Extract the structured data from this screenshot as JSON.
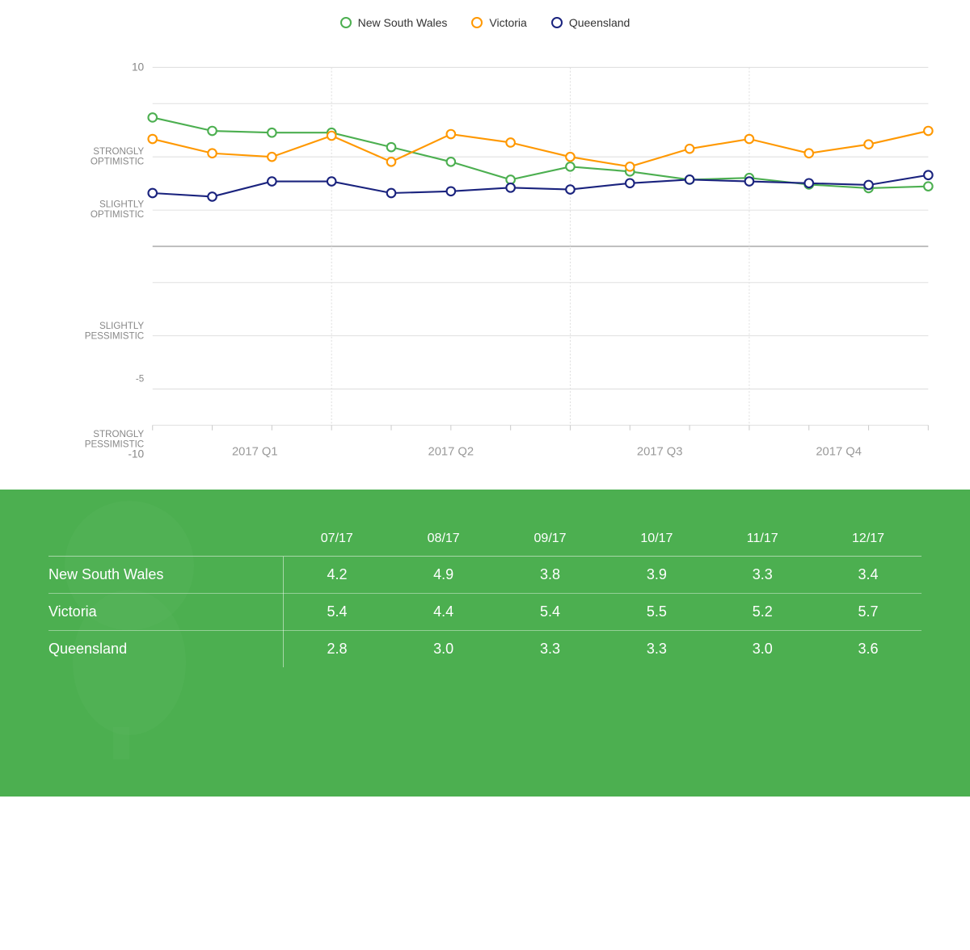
{
  "legend": {
    "items": [
      {
        "label": "New South Wales",
        "class": "nsw",
        "color": "#4caf50"
      },
      {
        "label": "Victoria",
        "class": "vic",
        "color": "#ff9800"
      },
      {
        "label": "Queensland",
        "class": "qld",
        "color": "#1a237e"
      }
    ]
  },
  "chart": {
    "yAxis": {
      "max": 10,
      "min": -10,
      "labels": [
        {
          "value": 10,
          "text": "10"
        },
        {
          "value": 7.5,
          "text": "STRONGLY\nOPTIMISTIC"
        },
        {
          "value": 2.5,
          "text": "SLIGHTLY\nOPTIMISTIC"
        },
        {
          "value": -2.5,
          "text": "SLIGHTLY\nPESSIMISTIC"
        },
        {
          "value": -7.5,
          "text": "STRONGLY\nPESSIMISTIC"
        },
        {
          "value": -10,
          "text": "-10"
        }
      ]
    },
    "xAxis": {
      "labels": [
        "2017 Q1",
        "2017 Q2",
        "2017 Q3",
        "2017 Q4"
      ]
    },
    "series": {
      "nsw": {
        "color": "#4caf50",
        "points": [
          7.2,
          6.5,
          6.4,
          6.4,
          5.6,
          4.8,
          3.8,
          4.5,
          4.2,
          3.8,
          3.9,
          3.5,
          3.3,
          3.4
        ]
      },
      "vic": {
        "color": "#ff9800",
        "points": [
          6.0,
          5.2,
          5.0,
          6.2,
          4.8,
          6.3,
          5.8,
          5.0,
          4.5,
          5.5,
          6.0,
          5.2,
          5.7,
          6.5
        ]
      },
      "qld": {
        "color": "#1a237e",
        "points": [
          2.5,
          2.3,
          3.2,
          3.2,
          2.5,
          2.6,
          2.8,
          2.7,
          3.1,
          3.3,
          3.2,
          3.1,
          3.0,
          3.6
        ]
      }
    }
  },
  "table": {
    "columns": [
      "",
      "07/17",
      "08/17",
      "09/17",
      "10/17",
      "11/17",
      "12/17"
    ],
    "rows": [
      {
        "label": "New South Wales",
        "values": [
          "4.2",
          "4.9",
          "3.8",
          "3.9",
          "3.3",
          "3.4"
        ]
      },
      {
        "label": "Victoria",
        "values": [
          "5.4",
          "4.4",
          "5.4",
          "5.5",
          "5.2",
          "5.7"
        ]
      },
      {
        "label": "Queensland",
        "values": [
          "2.8",
          "3.0",
          "3.3",
          "3.3",
          "3.0",
          "3.6"
        ]
      }
    ]
  }
}
